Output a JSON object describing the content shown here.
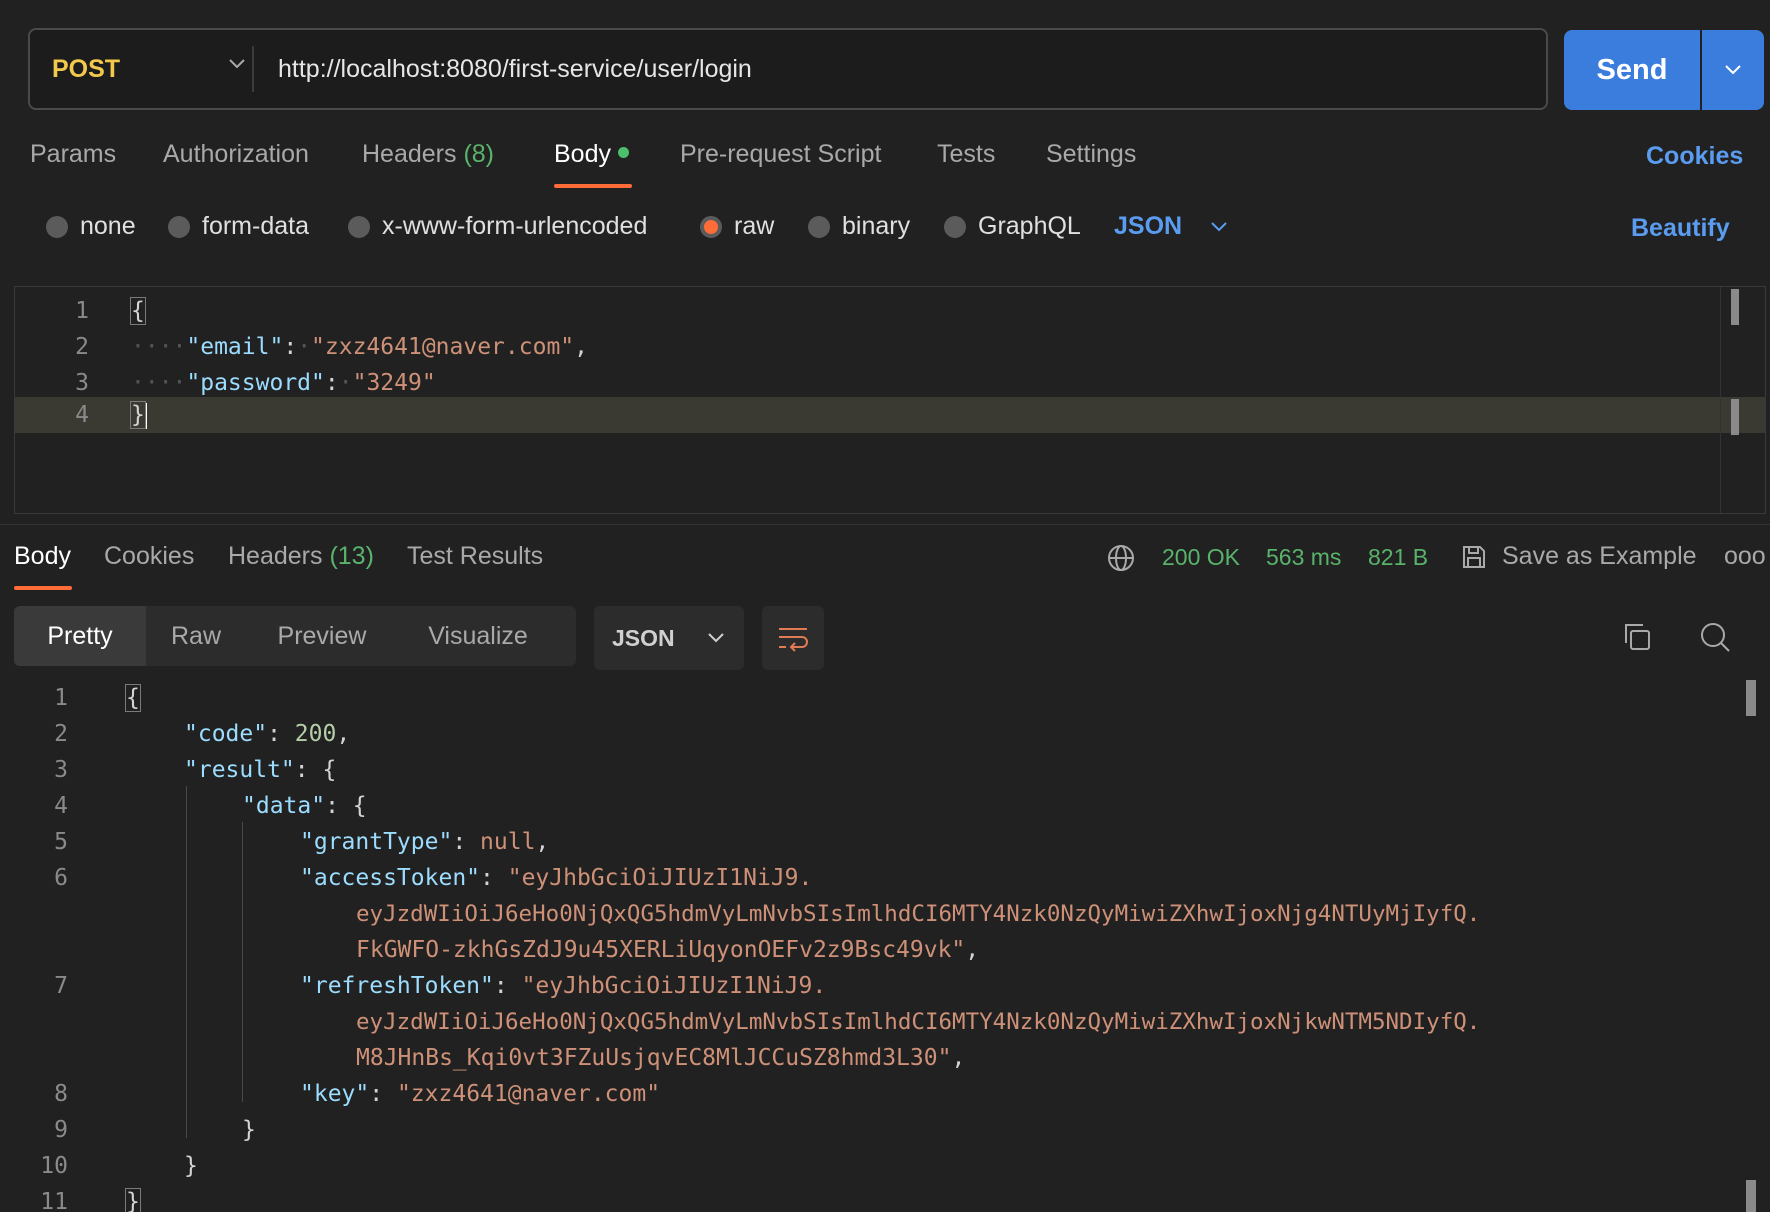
{
  "request": {
    "method": "POST",
    "url": "http://localhost:8080/first-service/user/login",
    "send_label": "Send"
  },
  "request_tabs": [
    {
      "label": "Params"
    },
    {
      "label": "Authorization"
    },
    {
      "label": "Headers",
      "count": "(8)"
    },
    {
      "label": "Body"
    },
    {
      "label": "Pre-request Script"
    },
    {
      "label": "Tests"
    },
    {
      "label": "Settings"
    }
  ],
  "cookies_label": "Cookies",
  "body_types": [
    "none",
    "form-data",
    "x-www-form-urlencoded",
    "raw",
    "binary",
    "GraphQL"
  ],
  "body_selected": "raw",
  "body_format": "JSON",
  "beautify_label": "Beautify",
  "request_body": {
    "line_numbers": [
      "1",
      "2",
      "3",
      "4"
    ],
    "open": "{",
    "close": "}",
    "email_key": "\"email\"",
    "email_value": "\"zxz4641@naver.com\"",
    "password_key": "\"password\"",
    "password_value": "\"3249\""
  },
  "response_tabs": [
    {
      "label": "Body"
    },
    {
      "label": "Cookies"
    },
    {
      "label": "Headers",
      "count": "(13)"
    },
    {
      "label": "Test Results"
    }
  ],
  "response_status": {
    "status": "200 OK",
    "time": "563 ms",
    "size": "821 B",
    "save_label": "Save as Example",
    "more": "ooo"
  },
  "view_modes": [
    "Pretty",
    "Raw",
    "Preview",
    "Visualize"
  ],
  "response_format": "JSON",
  "response_body": {
    "line_numbers": [
      "1",
      "2",
      "3",
      "4",
      "5",
      "6",
      "7",
      "8",
      "9",
      "10",
      "11"
    ],
    "code_key": "\"code\"",
    "code_value": "200",
    "result_key": "\"result\"",
    "data_key": "\"data\"",
    "grant_key": "\"grantType\"",
    "grant_value": "null",
    "access_key": "\"accessToken\"",
    "access_value_1": "\"eyJhbGciOiJIUzI1NiJ9.",
    "access_value_2": "eyJzdWIiOiJ6eHo0NjQxQG5hdmVyLmNvbSIsImlhdCI6MTY4Nzk0NzQyMiwiZXhwIjoxNjg4NTUyMjIyfQ.",
    "access_value_3": "FkGWFO-zkhGsZdJ9u45XERLiUqyonOEFv2z9Bsc49vk\"",
    "refresh_key": "\"refreshToken\"",
    "refresh_value_1": "\"eyJhbGciOiJIUzI1NiJ9.",
    "refresh_value_2": "eyJzdWIiOiJ6eHo0NjQxQG5hdmVyLmNvbSIsImlhdCI6MTY4Nzk0NzQyMiwiZXhwIjoxNjkwNTM5NDIyfQ.",
    "refresh_value_3": "M8JHnBs_Kqi0vt3FZuUsjqvEC8MlJCCuSZ8hmd3L30\"",
    "email_key": "\"key\"",
    "email_value": "\"zxz4641@naver.com\""
  },
  "colors": {
    "accent": "#3b7ddd",
    "method": "#f2c94c",
    "active_tab": "#ff6c37",
    "status_ok": "#59b36b"
  }
}
